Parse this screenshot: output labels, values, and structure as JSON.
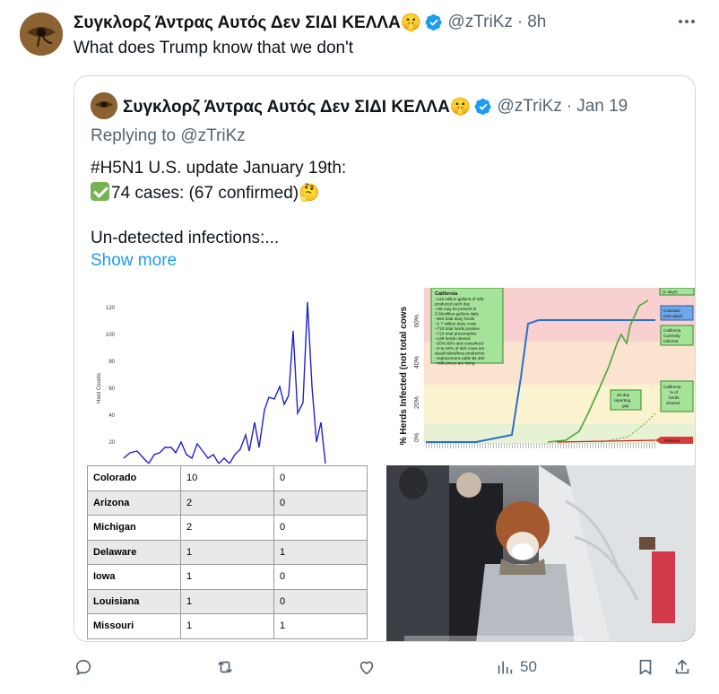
{
  "tweet": {
    "author_name": "Συγκλορζ Άντρας Αυτός Δεν ΣΙΔΙ ΚΕΛΛΑ🤫",
    "handle": "@zTriKz",
    "separator": "·",
    "time": "8h",
    "text": "What does Trump know that we don't"
  },
  "quoted": {
    "author_name": "Συγκλορζ Άντρας Αυτός Δεν ΣΙΔΙ ΚΕΛΛΑ🤫",
    "handle": "@zTriKz",
    "separator": "·",
    "time": "Jan 19",
    "replying_prefix": "Replying to",
    "replying_to": "@zTriKz",
    "line1": "#H5N1 U.S. update January 19th:",
    "line2": "74 cases: (67 confirmed)🤔",
    "line3": "Un-detected infections:...",
    "show_more": "Show more"
  },
  "media": {
    "line_chart": {
      "ylabel": "Herd Counts",
      "ticks": [
        "120",
        "100",
        "80",
        "60",
        "40",
        "20"
      ]
    },
    "state_table": {
      "rows": [
        [
          "Colorado",
          "10",
          "0"
        ],
        [
          "Arizona",
          "2",
          "0"
        ],
        [
          "Michigan",
          "2",
          "0"
        ],
        [
          "Delaware",
          "1",
          "1"
        ],
        [
          "Iowa",
          "1",
          "0"
        ],
        [
          "Louisiana",
          "1",
          "0"
        ],
        [
          "Missouri",
          "1",
          "1"
        ]
      ]
    },
    "herds_chart": {
      "ylabel": "% Herds Infected (not total cows",
      "ticks": [
        "60%",
        "40%",
        "20%",
        "0%"
      ],
      "info_box_title": "California",
      "info_lines": [
        "~115 million gallons of milk",
        "produced each day",
        "~H5 may be present in",
        "5-50million gallons daily",
        "~984 total dairy herds",
        "~1.7 million dairy cows",
        "~710 total herds positive",
        "~723 total presumptive",
        "~128 herds cleared",
        "~20%-60% sick cows/herd",
        "~2-to-10% of sick cows are",
        "dead/culled/less productive",
        "~replacement cattle $4,400",
        "~milk prices are rising"
      ],
      "label_days_top": "(1 days)",
      "label_colorado": "Colorado",
      "label_colorado_days": "(110 days)",
      "label_ca_infected_1": "California",
      "label_ca_infected_2": "Currently",
      "label_ca_infected_3": "Infected",
      "label_gap_1": "26-day",
      "label_gap_2": "reporting",
      "label_gap_3": "gap",
      "label_cleared_1": "California",
      "label_cleared_2": "% of",
      "label_cleared_3": "herds",
      "label_cleared_4": "cleared",
      "label_missouri": "Missouri"
    }
  },
  "actions": {
    "views": "50"
  },
  "colors": {
    "link": "#1d9bf0",
    "muted": "#536471",
    "verified": "#1d9bf0",
    "line_series": "#2222cc"
  }
}
